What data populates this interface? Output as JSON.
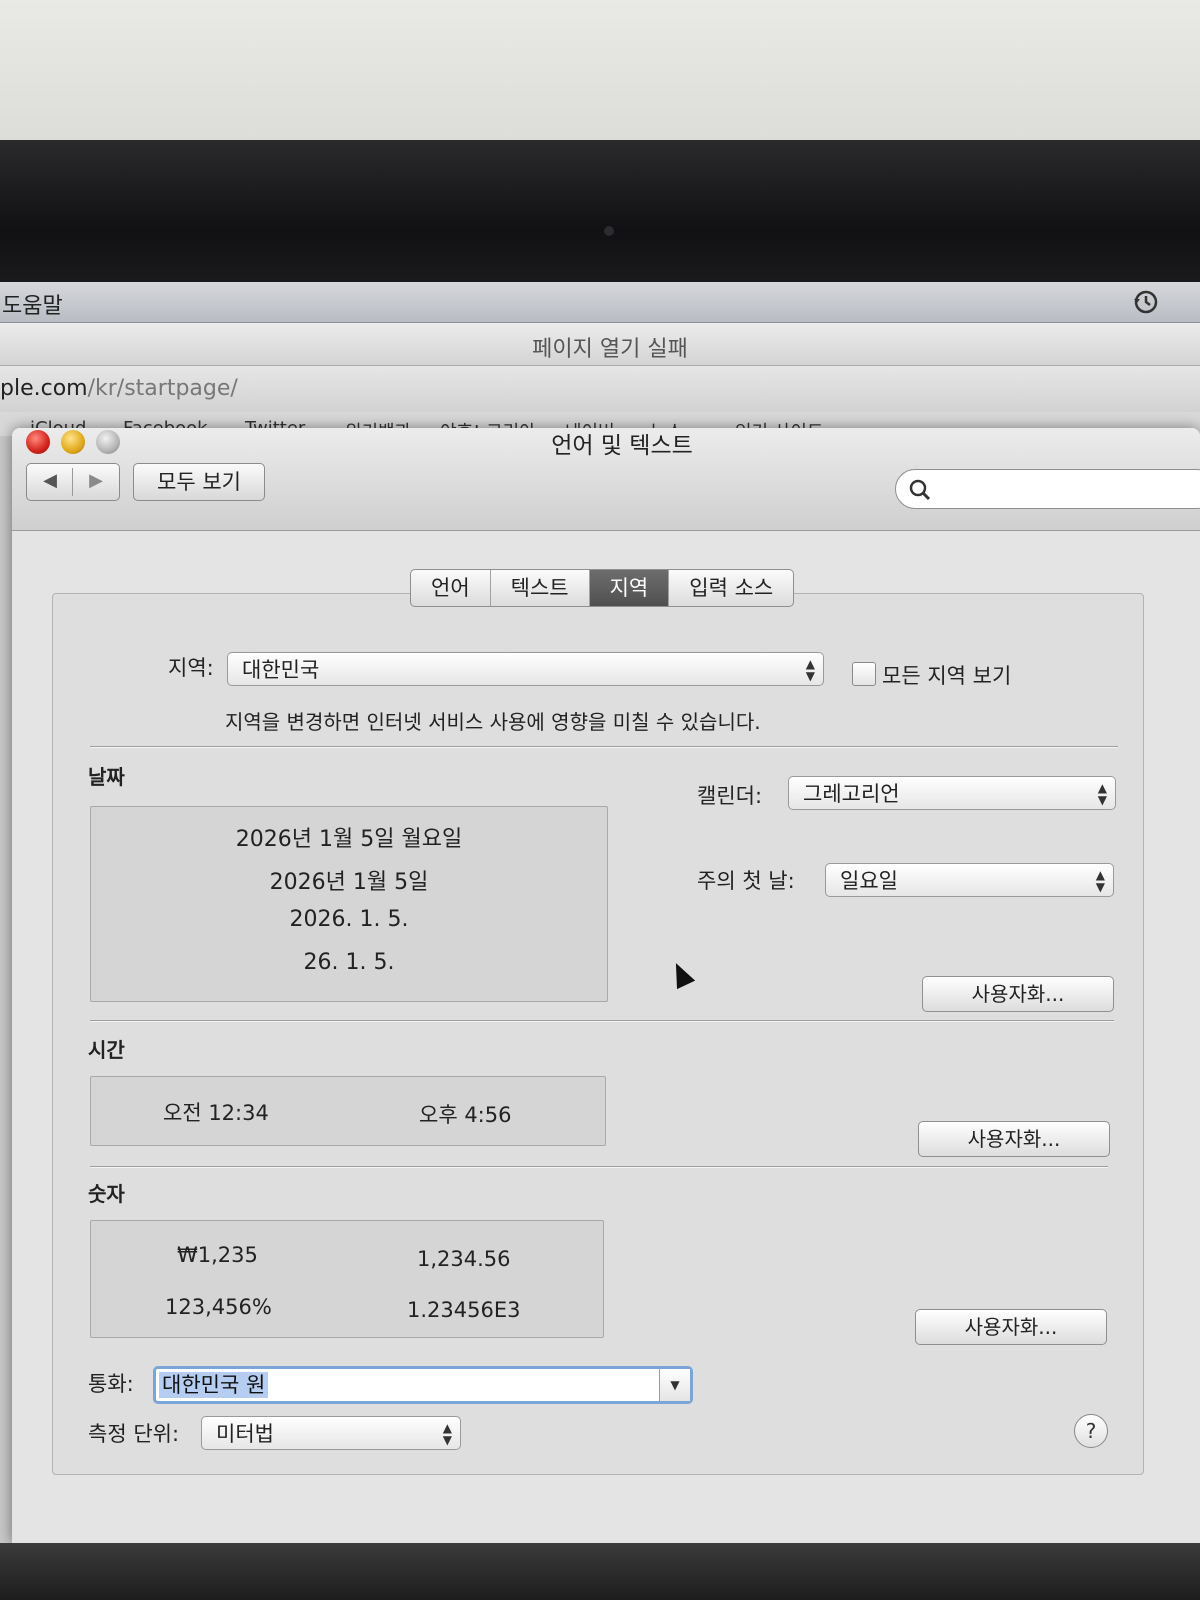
{
  "menubar": {
    "help_label": "도움말"
  },
  "browser": {
    "page_title": "페이지 열기 실패",
    "url_host": "ple.com",
    "url_path": "/kr/startpage/",
    "bookmarks": [
      "iCloud",
      "Facebook",
      "Twitter",
      "위키백과",
      "야후! 코리아",
      "네이버",
      "뉴스 ▾",
      "인기 사이트 ▾"
    ]
  },
  "prefs": {
    "window_title": "언어 및 텍스트",
    "show_all_label": "모두 보기",
    "search_placeholder": "",
    "tabs": [
      {
        "label": "언어",
        "active": false
      },
      {
        "label": "텍스트",
        "active": false
      },
      {
        "label": "지역",
        "active": true
      },
      {
        "label": "입력 소스",
        "active": false
      }
    ],
    "region": {
      "label": "지역:",
      "value": "대한민국",
      "show_all_label": "모든 지역 보기",
      "show_all_checked": false,
      "note": "지역을 변경하면 인터넷 서비스 사용에 영향을 미칠 수 있습니다."
    },
    "date": {
      "title": "날짜",
      "samples": [
        "2026년 1월 5일 월요일",
        "2026년 1월 5일",
        "2026. 1. 5.",
        "26. 1. 5."
      ],
      "calendar_label": "캘린더:",
      "calendar_value": "그레고리언",
      "first_day_label": "주의 첫 날:",
      "first_day_value": "일요일",
      "customize_label": "사용자화..."
    },
    "time": {
      "title": "시간",
      "samples": [
        "오전 12:34",
        "오후 4:56"
      ],
      "customize_label": "사용자화..."
    },
    "numbers": {
      "title": "숫자",
      "samples": [
        "₩1,235",
        "1,234.56",
        "123,456%",
        "1.23456E3"
      ],
      "customize_label": "사용자화..."
    },
    "currency": {
      "label": "통화:",
      "value": "대한민국 원"
    },
    "measurement": {
      "label": "측정 단위:",
      "value": "미터법"
    },
    "help_label": "?"
  },
  "colors": {
    "selection": "#b4cdf0",
    "focus_ring": "#7ba4d8",
    "close": "#d2221b",
    "minimize": "#e0a81a"
  }
}
